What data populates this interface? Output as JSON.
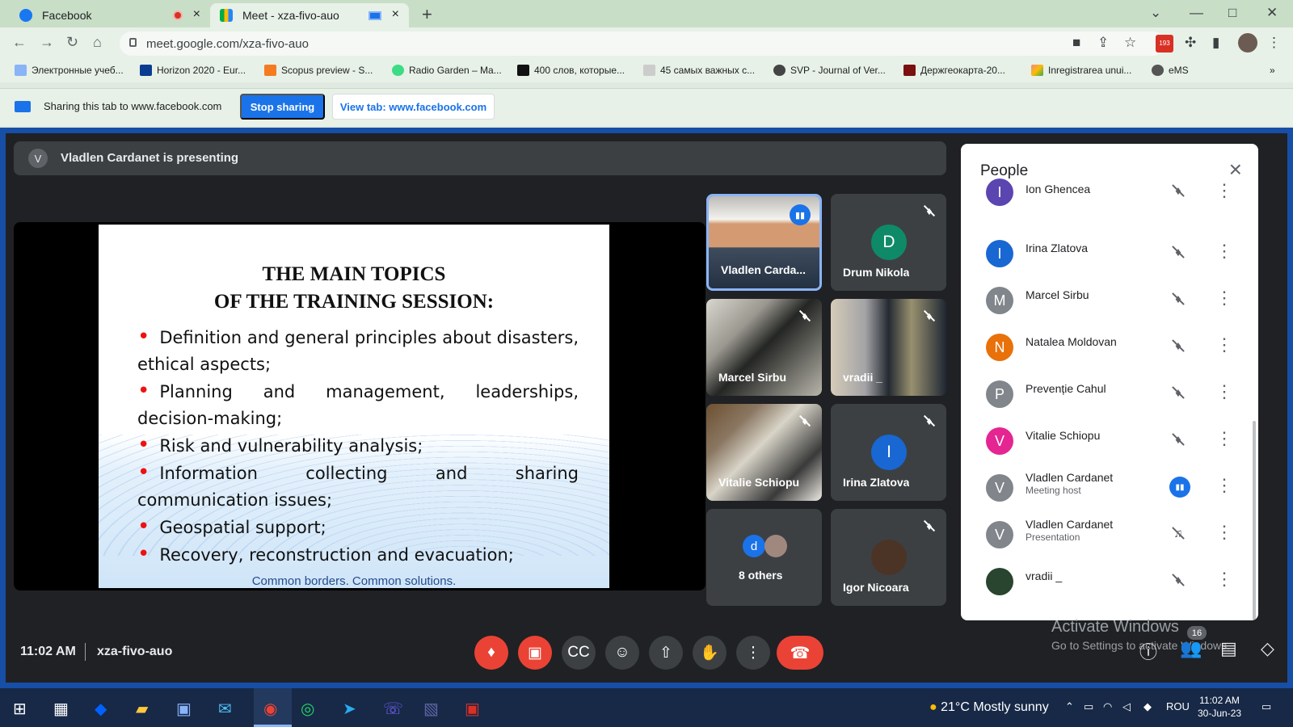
{
  "browser": {
    "tabs": [
      {
        "title": "Facebook"
      },
      {
        "title": "Meet - xza-fivo-auo"
      }
    ],
    "url": "meet.google.com/xza-fivo-auo",
    "extension_badge": "193",
    "bookmarks": [
      "Электронные учеб...",
      "Horizon 2020 - Eur...",
      "Scopus preview - S...",
      "Radio Garden – Ma...",
      "400 слов, которые...",
      "45 самых важных с...",
      "SVP - Journal of Ver...",
      "Держгеокарта-20...",
      "Inregistrarea unui...",
      "eMS"
    ],
    "bookmark_overflow": "»"
  },
  "share_bar": {
    "text": "Sharing this tab to www.facebook.com",
    "stop": "Stop sharing",
    "view": "View tab: www.facebook.com"
  },
  "meet": {
    "presenter_initial": "V",
    "presenting_text": "Vladlen Cardanet is presenting",
    "slide": {
      "title_line_1": "THE MAIN TOPICS",
      "title_line_2": "OF THE TRAINING SESSION:",
      "items": [
        "Definition and general principles about disasters, ethical aspects;",
        "Planning and management, leaderships, decision-making;",
        "Risk and vulnerability analysis;",
        "Information collecting and sharing communication issues;",
        "Geospatial support;",
        "Recovery, reconstruction and evacuation;"
      ],
      "footer": "Common borders. Common solutions."
    },
    "tiles": [
      {
        "name": "Vladlen Carda..."
      },
      {
        "name": "Drum Nikola",
        "initial": "D"
      },
      {
        "name": "Marcel Sirbu"
      },
      {
        "name": "vradii _"
      },
      {
        "name": "Vitalie Schiopu"
      },
      {
        "name": "Irina Zlatova",
        "initial": "I"
      },
      {
        "name": "8 others",
        "initial": "d"
      },
      {
        "name": "Igor Nicoara"
      }
    ],
    "time": "11:02 AM",
    "meeting_code": "xza-fivo-auo",
    "people_count": "16",
    "people_panel": {
      "title": "People",
      "people": [
        {
          "name": "Ion Ghencea",
          "initial": "I"
        },
        {
          "name": "Irina Zlatova",
          "initial": "I"
        },
        {
          "name": "Marcel Sirbu",
          "initial": "M"
        },
        {
          "name": "Natalea Moldovan",
          "initial": "N"
        },
        {
          "name": "Prevenție Cahul",
          "initial": "P"
        },
        {
          "name": "Vitalie Schiopu",
          "initial": "V"
        },
        {
          "name": "Vladlen Cardanet",
          "sub": "Meeting host",
          "initial": "V"
        },
        {
          "name": "Vladlen Cardanet",
          "sub": "Presentation",
          "initial": "V"
        },
        {
          "name": "vradii _"
        }
      ]
    },
    "watermark": {
      "title": "Activate Windows",
      "subtitle": "Go to Settings to activate Windows."
    }
  },
  "taskbar": {
    "temperature": "21°C",
    "weather": "Mostly sunny",
    "language": "ROU",
    "time": "11:02 AM",
    "date": "30-Jun-23"
  },
  "colors": {
    "google_blue": "#1a73e8",
    "meet_background": "#202124",
    "red": "#ea4335"
  }
}
